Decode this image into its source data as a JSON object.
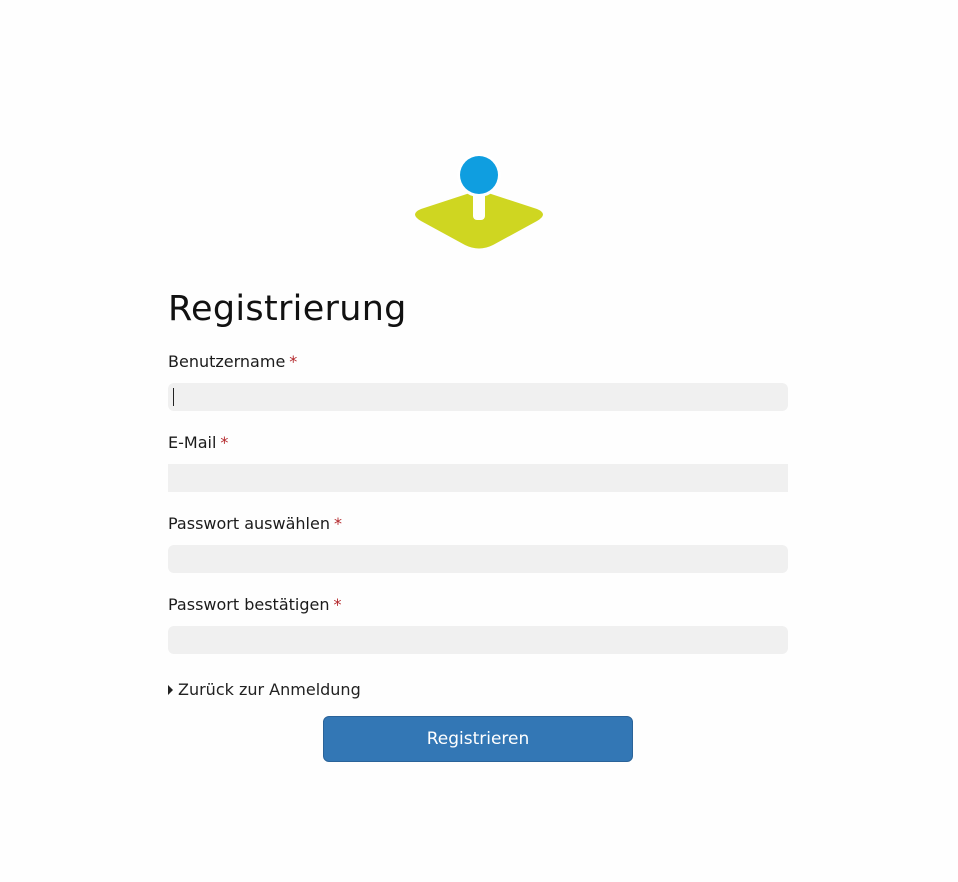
{
  "logo": {
    "name": "map-pin-logo",
    "colors": {
      "pin": "#0f9ee0",
      "base": "#cfd621"
    }
  },
  "form": {
    "title": "Registrierung",
    "required_marker": "*",
    "fields": [
      {
        "label": "Benutzername",
        "value": "",
        "focused": true
      },
      {
        "label": "E-Mail",
        "value": ""
      },
      {
        "label": "Passwort auswählen",
        "value": ""
      },
      {
        "label": "Passwort bestätigen",
        "value": ""
      }
    ],
    "back_link": "Zurück zur Anmeldung",
    "submit_label": "Registrieren"
  },
  "colors": {
    "accent": "#3377b5",
    "required": "#b3262a",
    "input_bg": "#f0f0f0"
  }
}
